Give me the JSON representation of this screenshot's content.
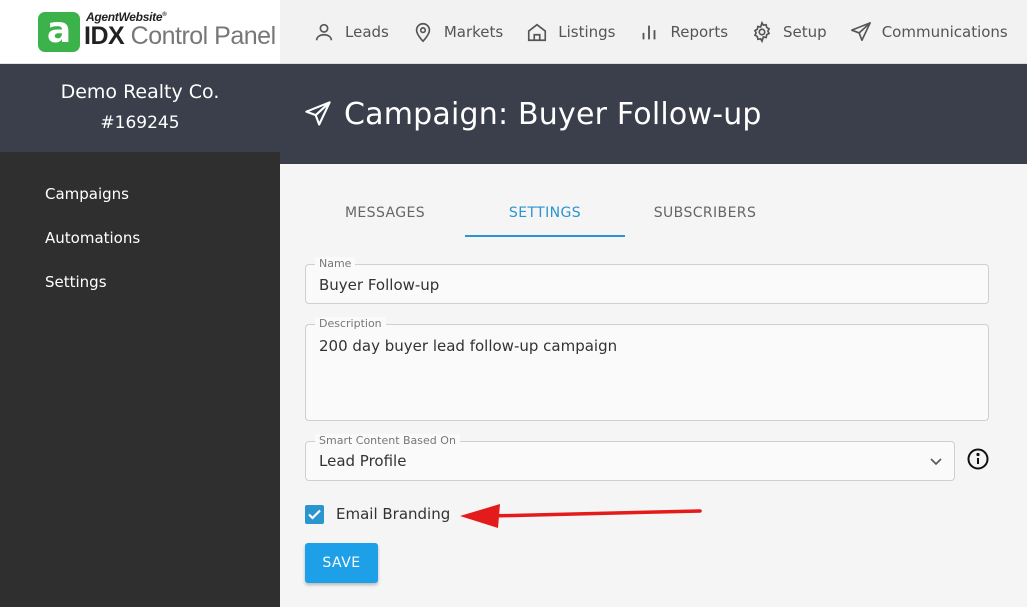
{
  "logo": {
    "mark": "a",
    "brand_top": "AgentWebsite",
    "brand_bold": "IDX",
    "brand_rest": "Control Panel",
    "accent": "#3cb34a"
  },
  "company": {
    "name": "Demo Realty Co.",
    "id": "#169245"
  },
  "sidebar": {
    "items": [
      {
        "label": "Campaigns"
      },
      {
        "label": "Automations"
      },
      {
        "label": "Settings"
      }
    ]
  },
  "topnav": {
    "items": [
      {
        "label": "Leads",
        "icon": "user-icon"
      },
      {
        "label": "Markets",
        "icon": "map-pin-icon"
      },
      {
        "label": "Listings",
        "icon": "house-icon"
      },
      {
        "label": "Reports",
        "icon": "bar-chart-icon"
      },
      {
        "label": "Setup",
        "icon": "gear-icon"
      },
      {
        "label": "Communications",
        "icon": "paper-plane-icon"
      }
    ]
  },
  "header": {
    "title": "Campaign: Buyer Follow-up",
    "icon": "paper-plane-icon"
  },
  "tabs": [
    {
      "label": "MESSAGES",
      "active": false
    },
    {
      "label": "SETTINGS",
      "active": true
    },
    {
      "label": "SUBSCRIBERS",
      "active": false
    }
  ],
  "form": {
    "name": {
      "label": "Name",
      "value": "Buyer Follow-up"
    },
    "description": {
      "label": "Description",
      "value": "200 day buyer lead follow-up campaign"
    },
    "smart_content": {
      "label": "Smart Content Based On",
      "value": "Lead Profile"
    },
    "email_branding": {
      "label": "Email Branding",
      "checked": true
    },
    "save_label": "SAVE"
  },
  "colors": {
    "accent_blue": "#2a95cf",
    "save_button": "#1ea0e8",
    "header_bg": "#3b3f4b",
    "sidebar_bg": "#2f2f2f",
    "annotation_arrow": "#e31b1b"
  }
}
